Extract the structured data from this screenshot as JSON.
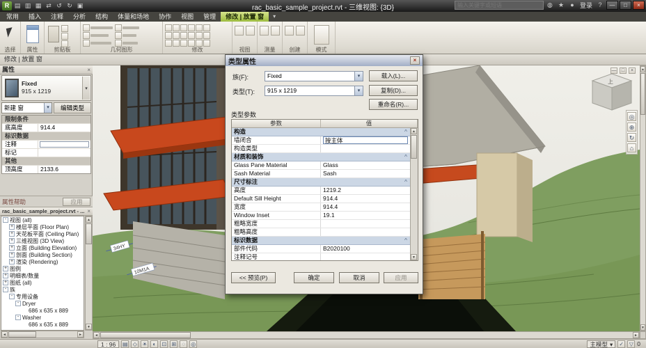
{
  "titlebar": {
    "title": "rac_basic_sample_project.rvt - 三维视图: {3D}",
    "search_placeholder": "输入关键字或短语",
    "signin": "登录"
  },
  "tabs": [
    "常用",
    "插入",
    "注释",
    "分析",
    "结构",
    "体量和场地",
    "协作",
    "视图",
    "管理",
    "修改 | 放置 窗"
  ],
  "ribbon_groups": [
    "选择",
    "属性",
    "剪贴板",
    "几何图形",
    "修改",
    "视图",
    "测量",
    "创建",
    "模式"
  ],
  "options_bar": "修改 | 放置 窗",
  "properties": {
    "title": "属性",
    "family": "Fixed",
    "type": "915 x 1219",
    "selector": "新建 窗",
    "edit_type": "编辑类型",
    "rows": [
      {
        "kind": "section",
        "label": "限制条件",
        "value": ""
      },
      {
        "kind": "param",
        "label": "底高度",
        "value": "914.4"
      },
      {
        "kind": "section",
        "label": "标识数据",
        "value": ""
      },
      {
        "kind": "param",
        "label": "注释",
        "value": ""
      },
      {
        "kind": "param",
        "label": "标记",
        "value": ""
      },
      {
        "kind": "section",
        "label": "其他",
        "value": ""
      },
      {
        "kind": "param",
        "label": "顶高度",
        "value": "2133.6"
      }
    ],
    "help": "属性帮助",
    "apply": "应用"
  },
  "browser": {
    "title": "rac_basic_sample_project.rvt - ...",
    "items": [
      {
        "label": "视图 (all)",
        "exp": "-"
      },
      {
        "label": "楼层平面 (Floor Plan)",
        "exp": "+"
      },
      {
        "label": "天花板平面 (Ceiling Plan)",
        "exp": "+"
      },
      {
        "label": "三维视图 (3D View)",
        "exp": "+"
      },
      {
        "label": "立面 (Building Elevation)",
        "exp": "+"
      },
      {
        "label": "剖面 (Building Section)",
        "exp": "+"
      },
      {
        "label": "渲染 (Rendering)",
        "exp": "+"
      },
      {
        "label": "图例",
        "exp": "+"
      },
      {
        "label": "明细表/数量",
        "exp": "+"
      },
      {
        "label": "图纸 (all)",
        "exp": "+"
      },
      {
        "label": "族",
        "exp": "-"
      },
      {
        "label": "专用设备",
        "exp": "-"
      },
      {
        "label": "Dryer",
        "exp": "-"
      },
      {
        "label": "686 x 635 x 889",
        "exp": ""
      },
      {
        "label": "Washer",
        "exp": "-"
      },
      {
        "label": "686 x 635 x 889",
        "exp": ""
      }
    ]
  },
  "dialog": {
    "title": "类型属性",
    "family_label": "族(F):",
    "family_value": "Fixed",
    "load_button": "载入(L)...",
    "type_label": "类型(T):",
    "type_value": "915 x 1219",
    "duplicate_button": "复制(D)...",
    "rename_button": "重命名(R)...",
    "params_label": "类型参数",
    "col_param": "参数",
    "col_value": "值",
    "rows": [
      {
        "kind": "group",
        "label": "构造",
        "value": ""
      },
      {
        "kind": "param",
        "label": "墙闭合",
        "value": "按主体"
      },
      {
        "kind": "param",
        "label": "构造类型",
        "value": ""
      },
      {
        "kind": "group",
        "label": "材质和装饰",
        "value": ""
      },
      {
        "kind": "param",
        "label": "Glass Pane Material",
        "value": "Glass"
      },
      {
        "kind": "param",
        "label": "Sash Material",
        "value": "Sash"
      },
      {
        "kind": "group",
        "label": "尺寸标注",
        "value": ""
      },
      {
        "kind": "param",
        "label": "高度",
        "value": "1219.2"
      },
      {
        "kind": "param",
        "label": "Default Sill Height",
        "value": "914.4"
      },
      {
        "kind": "param",
        "label": "宽度",
        "value": "914.4"
      },
      {
        "kind": "param",
        "label": "Window Inset",
        "value": "19.1"
      },
      {
        "kind": "param",
        "label": "粗略宽度",
        "value": ""
      },
      {
        "kind": "param",
        "label": "粗略高度",
        "value": ""
      },
      {
        "kind": "group",
        "label": "标识数据",
        "value": ""
      },
      {
        "kind": "param",
        "label": "部件代码",
        "value": "B2020100"
      },
      {
        "kind": "param",
        "label": "注释记号",
        "value": ""
      }
    ],
    "preview_button": "<< 预览(P)",
    "ok_button": "确定",
    "cancel_button": "取消",
    "apply_button": "应用"
  },
  "viewport": {
    "win_min": "—",
    "win_max": "□",
    "win_close": "×",
    "viewcube_top": "上",
    "tag1": "34HY",
    "tag2": "10M1A"
  },
  "statusbar": {
    "scale": "1 : 96",
    "design_option": "主模型",
    "count": "0"
  },
  "icons": {
    "app_logo": "R",
    "new": "▤",
    "open": "▥",
    "save": "▦",
    "sync": "⇄",
    "undo": "↺",
    "redo": "↻",
    "print": "▣",
    "comm": "◍",
    "fav": "★",
    "user": "●",
    "help": "?",
    "min": "—",
    "restore": "□",
    "close": "×",
    "chevron": "▾",
    "pin": "^",
    "wheel": "◎",
    "zoom": "⊕",
    "orbit": "↻",
    "home": "⌂",
    "detail": "▤",
    "style": "◇",
    "sun": "☀",
    "shadow": "◐",
    "crop": "⊡",
    "cropvis": "⊞",
    "hide": "◌",
    "reveal": "◎",
    "funnel": "▽",
    "check": "✓",
    "up": "▲",
    "down": "▼",
    "left": "◄",
    "right": "►"
  }
}
